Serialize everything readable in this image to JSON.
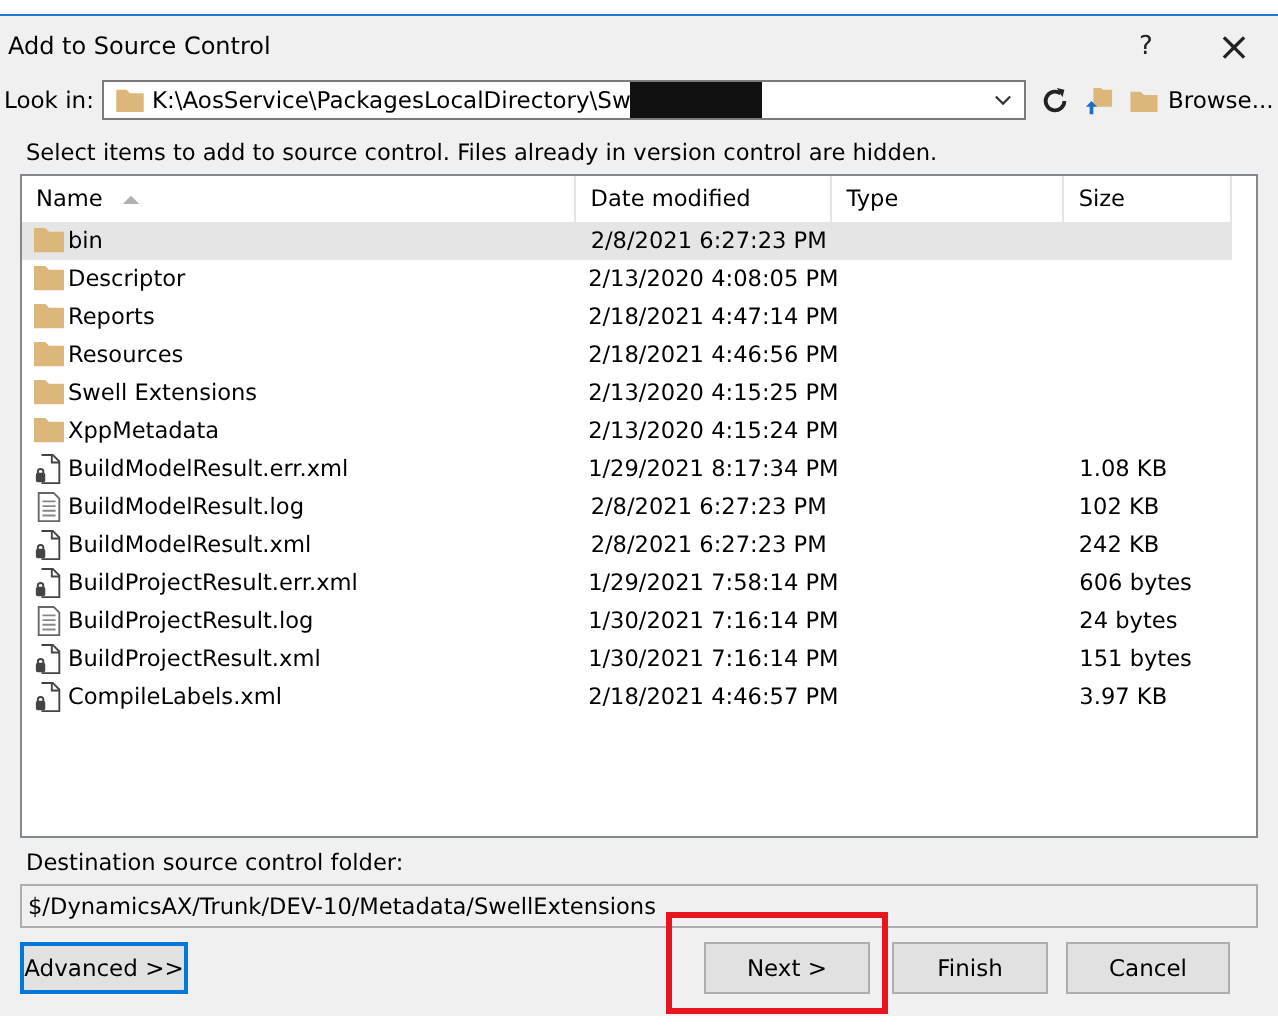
{
  "window": {
    "title": "Add to Source Control",
    "help": "?",
    "close": "×"
  },
  "look_in": {
    "label": "Look in:",
    "path": "K:\\AosService\\PackagesLocalDirectory\\Sw",
    "redacted": true,
    "browse": "Browse..."
  },
  "hint": "Select items to add to source control. Files already in version control are hidden.",
  "table": {
    "columns": [
      {
        "label": "Name",
        "sorted": true
      },
      {
        "label": "Date modified",
        "sorted": false
      },
      {
        "label": "Type",
        "sorted": false
      },
      {
        "label": "Size",
        "sorted": false
      }
    ],
    "rows": [
      {
        "kind": "folder",
        "name": "bin",
        "date": "2/8/2021 6:27:23 PM",
        "size": "",
        "selected": true
      },
      {
        "kind": "folder",
        "name": "Descriptor",
        "date": "2/13/2020 4:08:05 PM",
        "size": "",
        "selected": false
      },
      {
        "kind": "folder",
        "name": "Reports",
        "date": "2/18/2021 4:47:14 PM",
        "size": "",
        "selected": false
      },
      {
        "kind": "folder",
        "name": "Resources",
        "date": "2/18/2021 4:46:56 PM",
        "size": "",
        "selected": false
      },
      {
        "kind": "folder",
        "name": "Swell Extensions",
        "date": "2/13/2020 4:15:25 PM",
        "size": "",
        "selected": false
      },
      {
        "kind": "folder",
        "name": "XppMetadata",
        "date": "2/13/2020 4:15:24 PM",
        "size": "",
        "selected": false
      },
      {
        "kind": "xml",
        "name": "BuildModelResult.err.xml",
        "date": "1/29/2021 8:17:34 PM",
        "size": "1.08 KB",
        "selected": false
      },
      {
        "kind": "log",
        "name": "BuildModelResult.log",
        "date": "2/8/2021 6:27:23 PM",
        "size": "102 KB",
        "selected": false
      },
      {
        "kind": "xml",
        "name": "BuildModelResult.xml",
        "date": "2/8/2021 6:27:23 PM",
        "size": "242 KB",
        "selected": false
      },
      {
        "kind": "xml",
        "name": "BuildProjectResult.err.xml",
        "date": "1/29/2021 7:58:14 PM",
        "size": "606 bytes",
        "selected": false
      },
      {
        "kind": "log",
        "name": "BuildProjectResult.log",
        "date": "1/30/2021 7:16:14 PM",
        "size": "24 bytes",
        "selected": false
      },
      {
        "kind": "xml",
        "name": "BuildProjectResult.xml",
        "date": "1/30/2021 7:16:14 PM",
        "size": "151 bytes",
        "selected": false
      },
      {
        "kind": "xml",
        "name": "CompileLabels.xml",
        "date": "2/18/2021 4:46:57 PM",
        "size": "3.97 KB",
        "selected": false
      }
    ]
  },
  "destination": {
    "label": "Destination source control folder:",
    "value": "$/DynamicsAX/Trunk/DEV-10/Metadata/SwellExtensions"
  },
  "buttons": [
    {
      "label": "Advanced >>",
      "focused": true,
      "highlighted": false
    },
    {
      "label": "Next >",
      "focused": false,
      "highlighted": true
    },
    {
      "label": "Finish",
      "focused": false,
      "highlighted": false
    },
    {
      "label": "Cancel",
      "focused": false,
      "highlighted": false
    }
  ]
}
